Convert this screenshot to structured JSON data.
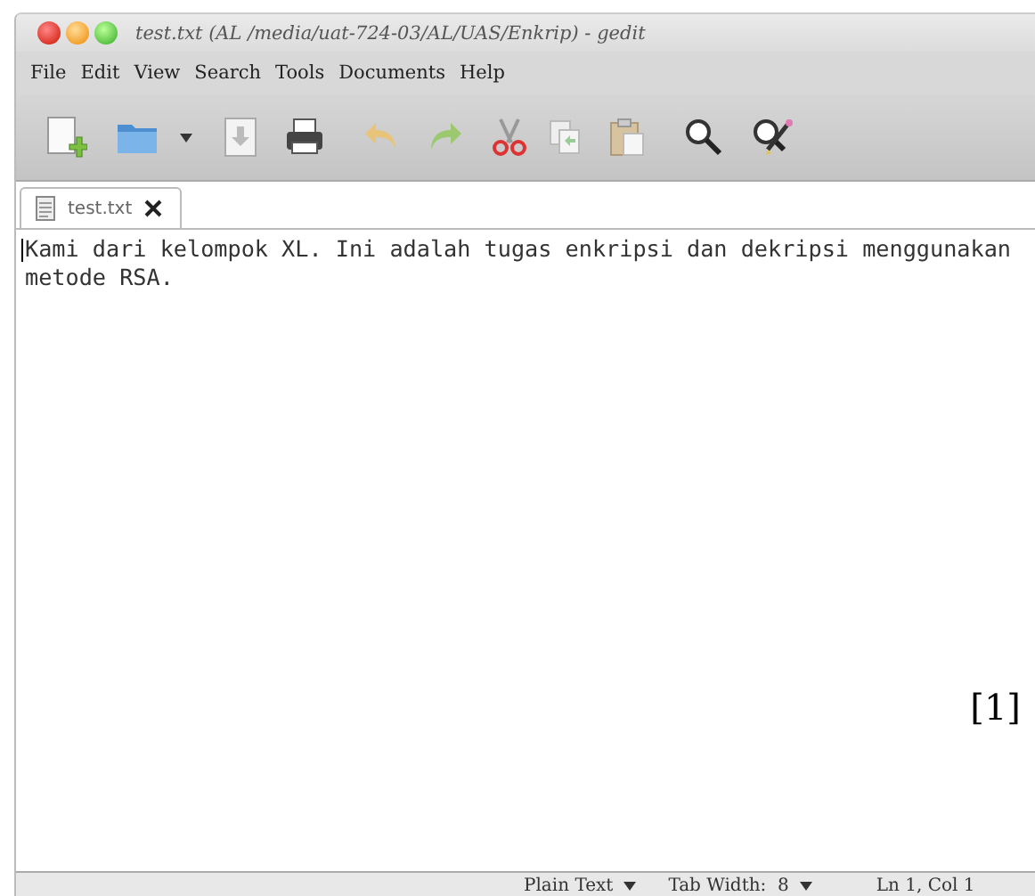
{
  "window": {
    "title": "test.txt (AL /media/uat-724-03/AL/UAS/Enkrip) - gedit"
  },
  "menu": [
    "File",
    "Edit",
    "View",
    "Search",
    "Tools",
    "Documents",
    "Help"
  ],
  "tabs": [
    {
      "label": "test.txt",
      "selected": true
    }
  ],
  "editor": {
    "lines": [
      "Kami dari kelompok XL. Ini adalah tugas enkripsi dan dekripsi menggunakan",
      "metode RSA."
    ]
  },
  "figure_label": "[1]",
  "status_bar": {
    "language": "Plain Text",
    "tab_width": "Tab Width:  8",
    "position": "Ln 1, Col 1"
  }
}
